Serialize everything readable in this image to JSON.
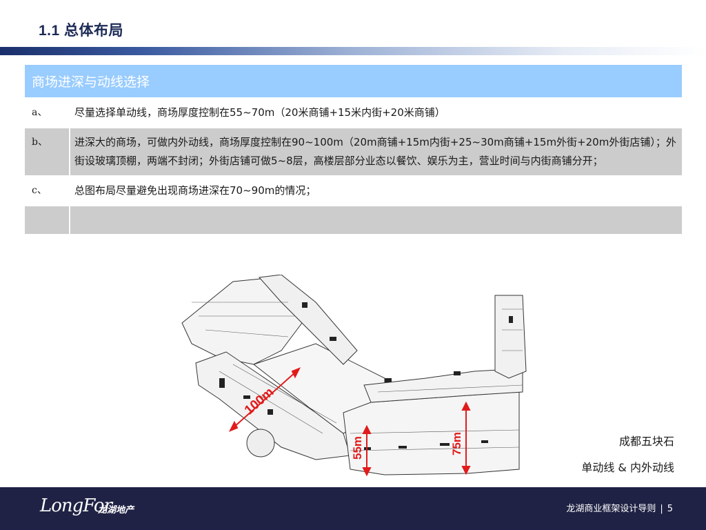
{
  "header": {
    "title": "1.1 总体布局"
  },
  "table": {
    "heading": "商场进深与动线选择",
    "rows": [
      {
        "key": "a、",
        "text": "尽量选择单动线，商场厚度控制在55~70m（20米商铺+15米内街+20米商铺）"
      },
      {
        "key": "b、",
        "text": "进深大的商场，可做内外动线，商场厚度控制在90~100m（20m商铺+15m内街+25~30m商铺+15m外街+20m外街店铺）；外街设玻璃顶棚，两端不封闭；外街店铺可做5~8层，高楼层部分业态以餐饮、娱乐为主，营业时间与内街商铺分开；"
      },
      {
        "key": "c、",
        "text": "总图布局尽量避免出现商场进深在70~90m的情况；"
      },
      {
        "key": "",
        "text": ""
      }
    ]
  },
  "plan": {
    "dimension_labels": [
      "100m",
      "55m",
      "75m"
    ],
    "accent_color": "#e11b1b"
  },
  "captions": {
    "place": "成都五块石",
    "circulation": "单动线 & 内外动线"
  },
  "footer": {
    "logo_text": "LongFor",
    "logo_cn": "龙湖地产",
    "doc_title": "龙湖商业框架设计导则",
    "separator": "|",
    "page_number": "5"
  }
}
